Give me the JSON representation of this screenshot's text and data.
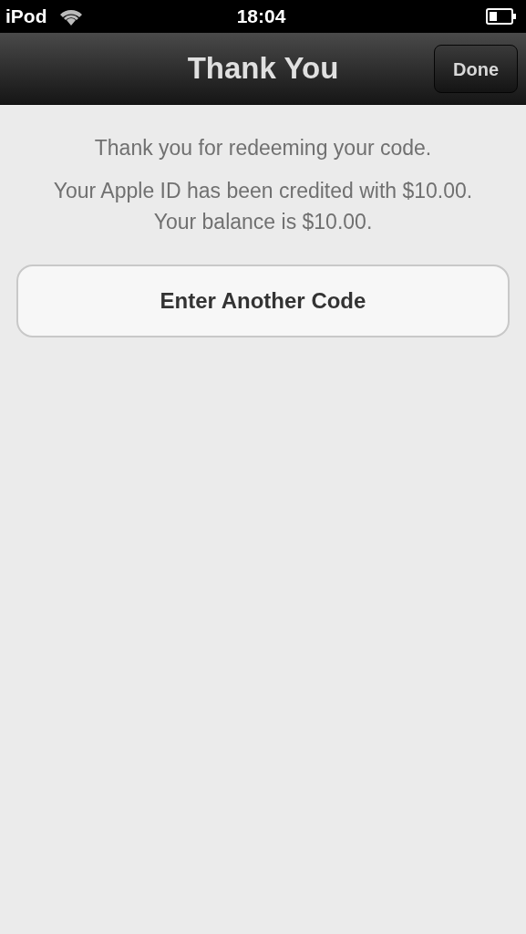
{
  "status_bar": {
    "carrier": "iPod",
    "time": "18:04"
  },
  "nav_bar": {
    "title": "Thank You",
    "done_button": "Done"
  },
  "messages": [
    "Thank you for redeeming your code.",
    "Your Apple ID has been credited with $10.00. Your balance is $10.00."
  ],
  "action_button": "Enter Another Code"
}
